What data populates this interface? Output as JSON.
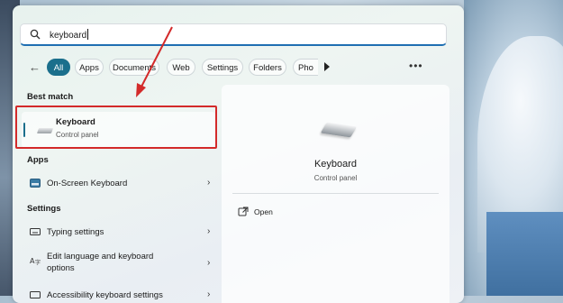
{
  "search": {
    "value": "keyboard"
  },
  "filters": [
    {
      "label": "All",
      "active": true
    },
    {
      "label": "Apps"
    },
    {
      "label": "Documents"
    },
    {
      "label": "Web"
    },
    {
      "label": "Settings"
    },
    {
      "label": "Folders"
    },
    {
      "label": "Pho"
    }
  ],
  "more_label": "•••",
  "best_match": {
    "heading": "Best match",
    "title": "Keyboard",
    "subtitle": "Control panel"
  },
  "apps": {
    "heading": "Apps",
    "items": [
      {
        "label": "On-Screen Keyboard"
      }
    ]
  },
  "settings": {
    "heading": "Settings",
    "items": [
      {
        "label": "Typing settings"
      },
      {
        "label": "Edit language and keyboard",
        "label2": "options"
      },
      {
        "label": "Accessibility keyboard settings"
      }
    ]
  },
  "detail": {
    "title": "Keyboard",
    "subtitle": "Control panel",
    "action_open": "Open"
  },
  "colors": {
    "accent": "#1b6f8c",
    "highlight": "#d32a2a"
  }
}
